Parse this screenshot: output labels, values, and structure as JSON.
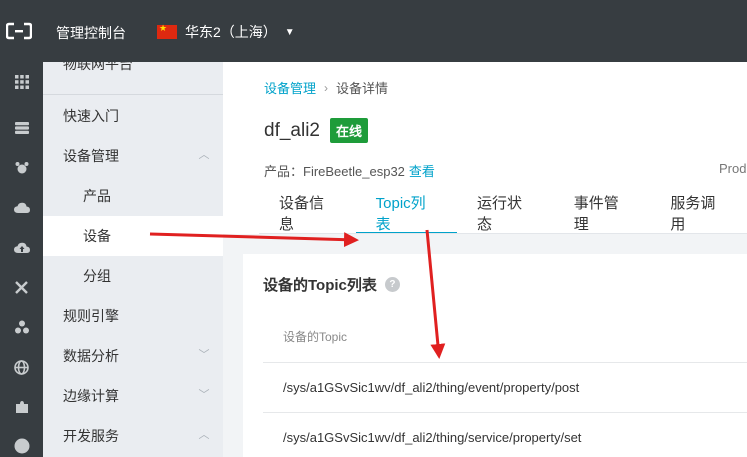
{
  "topbar": {
    "console_label": "管理控制台",
    "region_label": "华东2（上海）"
  },
  "sidebar": {
    "product_name": "物联网平台",
    "items": [
      {
        "label": "快速入门"
      },
      {
        "label": "设备管理"
      },
      {
        "label": "产品"
      },
      {
        "label": "设备"
      },
      {
        "label": "分组"
      },
      {
        "label": "规则引擎"
      },
      {
        "label": "数据分析"
      },
      {
        "label": "边缘计算"
      },
      {
        "label": "开发服务"
      }
    ]
  },
  "breadcrumb": {
    "parent": "设备管理",
    "current": "设备详情"
  },
  "device": {
    "name": "df_ali2",
    "status": "在线",
    "product_prefix": "产品：FireBeetle_esp32",
    "view_link": "查看",
    "truncated_right": "Prod"
  },
  "tabs": [
    {
      "label": "设备信息"
    },
    {
      "label": "Topic列表"
    },
    {
      "label": "运行状态"
    },
    {
      "label": "事件管理"
    },
    {
      "label": "服务调用"
    }
  ],
  "topic_card": {
    "title": "设备的Topic列表",
    "help_icon": "?",
    "column_header": "设备的Topic",
    "rows": [
      "/sys/a1GSvSic1wv/df_ali2/thing/event/property/post",
      "/sys/a1GSvSic1wv/df_ali2/thing/service/property/set"
    ]
  },
  "colors": {
    "topbar_bg": "#373d41",
    "accent": "#00a2ca",
    "online_badge": "#1e9c3a",
    "annotation_arrow": "#e02020"
  }
}
